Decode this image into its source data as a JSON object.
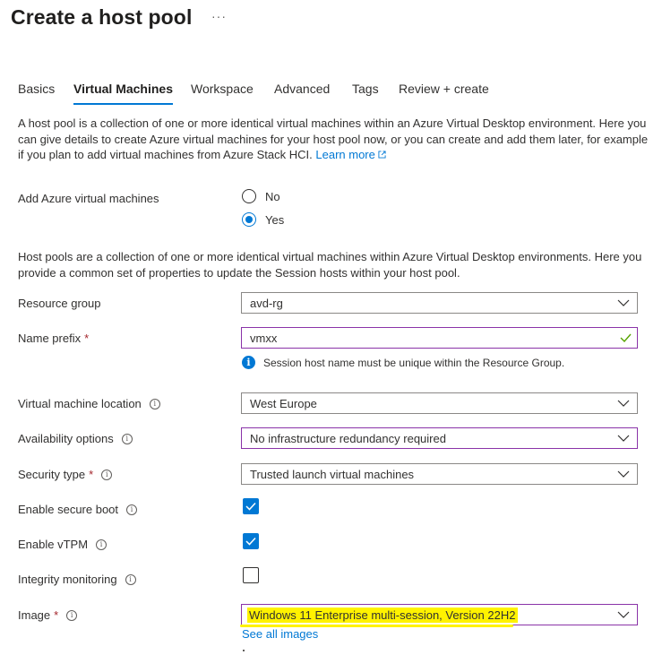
{
  "header": {
    "title": "Create a host pool",
    "more": "···"
  },
  "tabs": [
    {
      "label": "Basics",
      "active": false
    },
    {
      "label": "Virtual Machines",
      "active": true
    },
    {
      "label": "Workspace",
      "active": false
    },
    {
      "label": "Advanced",
      "active": false
    },
    {
      "label": "Tags",
      "active": false
    },
    {
      "label": "Review + create",
      "active": false
    }
  ],
  "intro": {
    "text": "A host pool is a collection of one or more identical virtual machines within an Azure Virtual Desktop environment. Here you can give details to create Azure virtual machines for your host pool now, or you can create and add them later, for example if you plan to add virtual machines from Azure Stack HCI.",
    "link": "Learn more"
  },
  "add_vms": {
    "label": "Add Azure virtual machines",
    "options": [
      "No",
      "Yes"
    ],
    "selected": "Yes"
  },
  "host_desc": "Host pools are a collection of one or more identical virtual machines within Azure Virtual Desktop environments. Here you provide a common set of properties to update the Session hosts within your host pool.",
  "fields": {
    "resource_group": {
      "label": "Resource group",
      "value": "avd-rg"
    },
    "name_prefix": {
      "label": "Name prefix",
      "required": "*",
      "value": "vmxx",
      "note": "Session host name must be unique within the Resource Group."
    },
    "location": {
      "label": "Virtual machine location",
      "value": "West Europe"
    },
    "availability": {
      "label": "Availability options",
      "value": "No infrastructure redundancy required"
    },
    "security_type": {
      "label": "Security type",
      "required": "*",
      "value": "Trusted launch virtual machines"
    },
    "secure_boot": {
      "label": "Enable secure boot",
      "checked": true
    },
    "vtpm": {
      "label": "Enable vTPM",
      "checked": true
    },
    "integrity": {
      "label": "Integrity monitoring",
      "checked": false
    },
    "image": {
      "label": "Image",
      "required": "*",
      "value": "Windows 11 Enterprise multi-session, Version 22H2",
      "link": "See all images"
    }
  },
  "colors": {
    "accent": "#0078d4",
    "highlight": "#fff200",
    "focus_border": "#8a33a8",
    "valid": "#57a300",
    "required": "#a4262c"
  }
}
